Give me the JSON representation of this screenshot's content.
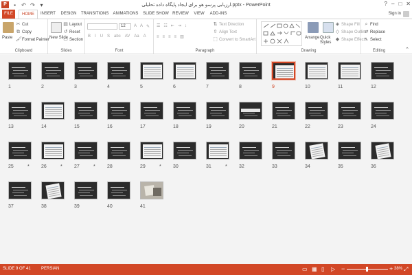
{
  "window": {
    "title": "ارزیابی پرسو هو برای ایجاد پایگاه داده تحلیلی.pptx - PowerPoint",
    "controls": [
      "?",
      "‒",
      "□",
      "✕"
    ]
  },
  "qat": {
    "app_icon": "P",
    "save_icon": "💾",
    "undo_icon": "↶",
    "redo_icon": "↷",
    "customize_icon": "▾"
  },
  "tabs": [
    "FILE",
    "HOME",
    "INSERT",
    "DESIGN",
    "TRANSITIONS",
    "ANIMATIONS",
    "SLIDE SHOW",
    "REVIEW",
    "VIEW",
    "ADD-INS"
  ],
  "active_tab": "HOME",
  "sign_in": "Sign in",
  "ribbon": {
    "clipboard": {
      "label": "Clipboard",
      "paste": "Paste",
      "cut": "Cut",
      "copy": "Copy",
      "format_painter": "Format Painter"
    },
    "slides": {
      "label": "Slides",
      "new_slide": "New Slide",
      "layout": "Layout",
      "reset": "Reset",
      "section": "Section"
    },
    "font": {
      "label": "Font",
      "size": "12",
      "buttons": [
        "B",
        "I",
        "U",
        "S",
        "abc",
        "AV",
        "Aa",
        "A"
      ]
    },
    "paragraph": {
      "label": "Paragraph",
      "text_direction": "Text Direction",
      "align_text": "Align Text",
      "convert_smartart": "Convert to SmartArt"
    },
    "drawing": {
      "label": "Drawing",
      "arrange": "Arrange",
      "quick_styles": "Quick Styles",
      "shape_fill": "Shape Fill",
      "shape_outline": "Shape Outline",
      "shape_effects": "Shape Effects"
    },
    "editing": {
      "label": "Editing",
      "find": "Find",
      "replace": "Replace",
      "select": "Select"
    }
  },
  "slides": [
    {
      "num": "1",
      "star": false
    },
    {
      "num": "2",
      "star": false
    },
    {
      "num": "3",
      "star": false
    },
    {
      "num": "4",
      "star": false
    },
    {
      "num": "5",
      "star": false
    },
    {
      "num": "6",
      "star": false
    },
    {
      "num": "7",
      "star": false
    },
    {
      "num": "8",
      "star": false
    },
    {
      "num": "9",
      "star": false
    },
    {
      "num": "10",
      "star": false
    },
    {
      "num": "11",
      "star": false
    },
    {
      "num": "12",
      "star": false
    },
    {
      "num": "13",
      "star": false
    },
    {
      "num": "14",
      "star": false
    },
    {
      "num": "15",
      "star": false
    },
    {
      "num": "16",
      "star": false
    },
    {
      "num": "17",
      "star": false
    },
    {
      "num": "18",
      "star": false
    },
    {
      "num": "19",
      "star": false
    },
    {
      "num": "20",
      "star": false
    },
    {
      "num": "21",
      "star": false
    },
    {
      "num": "22",
      "star": false
    },
    {
      "num": "23",
      "star": false
    },
    {
      "num": "24",
      "star": false
    },
    {
      "num": "25",
      "star": true
    },
    {
      "num": "26",
      "star": true
    },
    {
      "num": "27",
      "star": true
    },
    {
      "num": "28",
      "star": false
    },
    {
      "num": "29",
      "star": true
    },
    {
      "num": "30",
      "star": false
    },
    {
      "num": "31",
      "star": true
    },
    {
      "num": "32",
      "star": false
    },
    {
      "num": "33",
      "star": false
    },
    {
      "num": "34",
      "star": false
    },
    {
      "num": "35",
      "star": false
    },
    {
      "num": "36",
      "star": false
    },
    {
      "num": "37",
      "star": false
    },
    {
      "num": "38",
      "star": false
    },
    {
      "num": "39",
      "star": false
    },
    {
      "num": "40",
      "star": false
    },
    {
      "num": "41",
      "star": false
    }
  ],
  "selected_slide": "9",
  "star_symbol": "*",
  "status": {
    "slide_info": "SLIDE 9 OF 41",
    "language": "PERSIAN",
    "zoom": "38%",
    "zoom_minus": "−",
    "zoom_plus": "+"
  },
  "colors": {
    "accent": "#d24726",
    "ribbon_bg": "#ffffff",
    "content_bg": "#f3f3f3",
    "slide_dark": "#2b2b2b"
  }
}
